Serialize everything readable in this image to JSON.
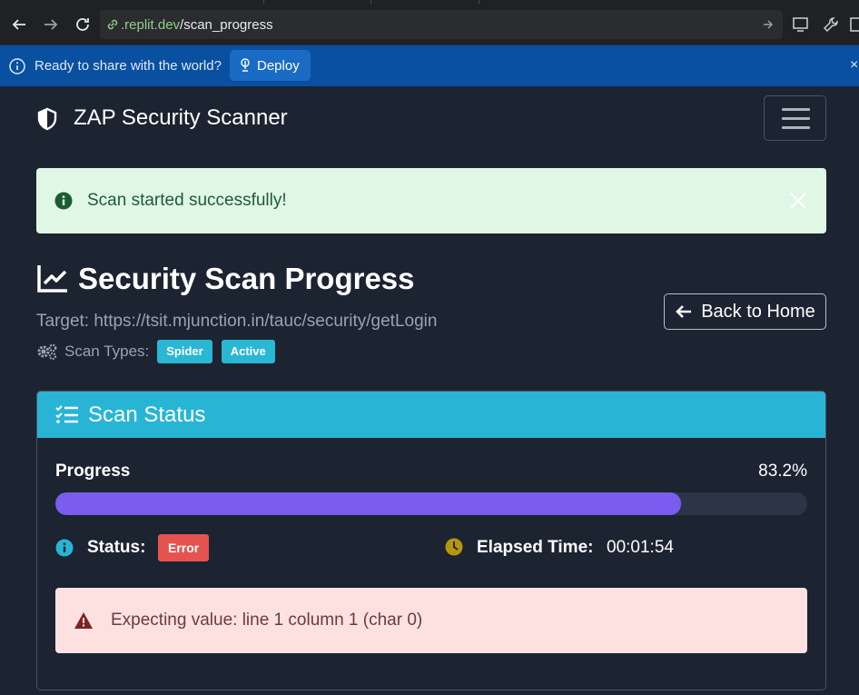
{
  "browser": {
    "url_domain": ".replit.dev",
    "url_path": "/scan_progress"
  },
  "deploy_bar": {
    "message": "Ready to share with the world?",
    "deploy_label": "Deploy",
    "close_glyph": "×"
  },
  "navbar": {
    "brand": "ZAP Security Scanner",
    "brand_icon": "shield-halved-icon",
    "toggler_icon": "hamburger-icon"
  },
  "flash": {
    "message": "Scan started successfully!",
    "icon": "info-circle-icon",
    "type": "success"
  },
  "page": {
    "title": "Security Scan Progress",
    "title_icon": "chart-line-icon",
    "target": "Target: https://tsit.mjunction.in/tauc/security/getLogin",
    "scan_types_label": "Scan Types:",
    "scan_types": [
      "Spider",
      "Active"
    ],
    "back_label": "Back to Home"
  },
  "status_card": {
    "title": "Scan Status",
    "progress_label": "Progress",
    "progress_value": "83.2%",
    "progress_fraction": 0.832,
    "status_label": "Status:",
    "status_badge": "Error",
    "elapsed_label": "Elapsed Time:",
    "elapsed_value": "00:01:54",
    "error_message": "Expecting value: line 1 column 1 (char 0)"
  },
  "colors": {
    "page_bg": "#1c2331",
    "info": "#28b5d5",
    "progress": "#7a5cf0",
    "danger": "#e55350",
    "success_bg": "#e1f7e5",
    "danger_bg": "#fde1e1",
    "deploy_bar": "#0a50a0"
  }
}
